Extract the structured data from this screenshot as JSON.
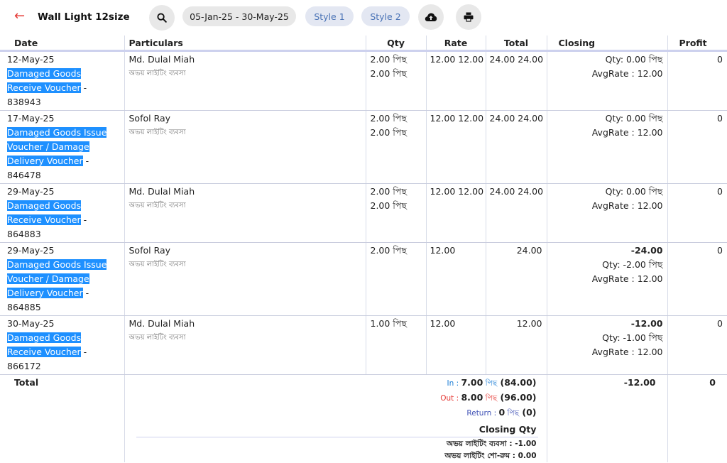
{
  "header": {
    "back_glyph": "←",
    "title": "Wall Light 12size",
    "date_range": "05-Jan-25 - 30-May-25",
    "style1": "Style 1",
    "style2": "Style 2"
  },
  "columns": [
    "Date",
    "Particulars",
    "Qty",
    "Rate",
    "Total",
    "Closing",
    "Profit"
  ],
  "rows": [
    {
      "date": "12-May-25",
      "voucher_type": "Damaged Goods Receive Voucher",
      "voucher_sep": " -",
      "voucher_no": "838943",
      "party": "Md. Dulal Miah",
      "location": "অভয় লাইটিং ব্যবসা",
      "qty1": "2.00 পিছ",
      "qty2": "2.00 পিছ",
      "rate": "12.00 12.00",
      "total": "24.00 24.00",
      "closing_amount": "",
      "closing_qty": "Qty: 0.00 পিছ",
      "closing_avg": "AvgRate : 12.00",
      "profit": "0"
    },
    {
      "date": "17-May-25",
      "voucher_type": "Damaged Goods Issue Voucher / Damage Delivery Voucher",
      "voucher_sep": " -",
      "voucher_no": "846478",
      "party": "Sofol Ray",
      "location": "অভয় লাইটিং ব্যবসা",
      "qty1": "2.00 পিছ",
      "qty2": "2.00 পিছ",
      "rate": "12.00 12.00",
      "total": "24.00 24.00",
      "closing_amount": "",
      "closing_qty": "Qty: 0.00 পিছ",
      "closing_avg": "AvgRate : 12.00",
      "profit": "0"
    },
    {
      "date": "29-May-25",
      "voucher_type": "Damaged Goods Receive Voucher",
      "voucher_sep": " -",
      "voucher_no": "864883",
      "party": "Md. Dulal Miah",
      "location": "অভয় লাইটিং ব্যবসা",
      "qty1": "2.00 পিছ",
      "qty2": "2.00 পিছ",
      "rate": "12.00 12.00",
      "total": "24.00 24.00",
      "closing_amount": "",
      "closing_qty": "Qty: 0.00 পিছ",
      "closing_avg": "AvgRate : 12.00",
      "profit": "0"
    },
    {
      "date": "29-May-25",
      "voucher_type": "Damaged Goods Issue Voucher / Damage Delivery Voucher",
      "voucher_sep": " -",
      "voucher_no": "864885",
      "party": "Sofol Ray",
      "location": "অভয় লাইটিং ব্যবসা",
      "qty1": "2.00 পিছ",
      "qty2": "",
      "rate": "12.00",
      "total": "24.00",
      "closing_amount": "-24.00",
      "closing_qty": "Qty: -2.00 পিছ",
      "closing_avg": "AvgRate : 12.00",
      "profit": "0"
    },
    {
      "date": "30-May-25",
      "voucher_type": "Damaged Goods Receive Voucher",
      "voucher_sep": " -",
      "voucher_no": "866172",
      "party": "Md. Dulal Miah",
      "location": "অভয় লাইটিং ব্যবসা",
      "qty1": "1.00 পিছ",
      "qty2": "",
      "rate": "12.00",
      "total": "12.00",
      "closing_amount": "-12.00",
      "closing_qty": "Qty: -1.00 পিছ",
      "closing_avg": "AvgRate : 12.00",
      "profit": "0"
    }
  ],
  "summary": {
    "label": "Total",
    "in_label": "In : ",
    "in_qty": "7.00",
    "in_unit": " পিছ",
    "in_amount": " (84.00)",
    "out_label": "Out : ",
    "out_qty": "8.00",
    "out_unit": " পিছ",
    "out_amount": " (96.00)",
    "return_label": "Return : ",
    "return_qty": "0",
    "return_unit": " পিছ",
    "return_amount": " (0)",
    "closing_qty_title": "Closing Qty",
    "closing_qty_lines": [
      "অভয় লাইটিং ব্যবসা : -1.00",
      "অভয় লাইটিং শো-রুম : 0.00"
    ],
    "closing_total": "-12.00",
    "profit_total": "0"
  },
  "colors": {
    "accent": "#1e90ff",
    "back_arrow": "#e53935",
    "pill_blue_text": "#4a73b6"
  },
  "icons": [
    "back-arrow-icon",
    "search-icon",
    "cloud-upload-icon",
    "print-icon"
  ]
}
